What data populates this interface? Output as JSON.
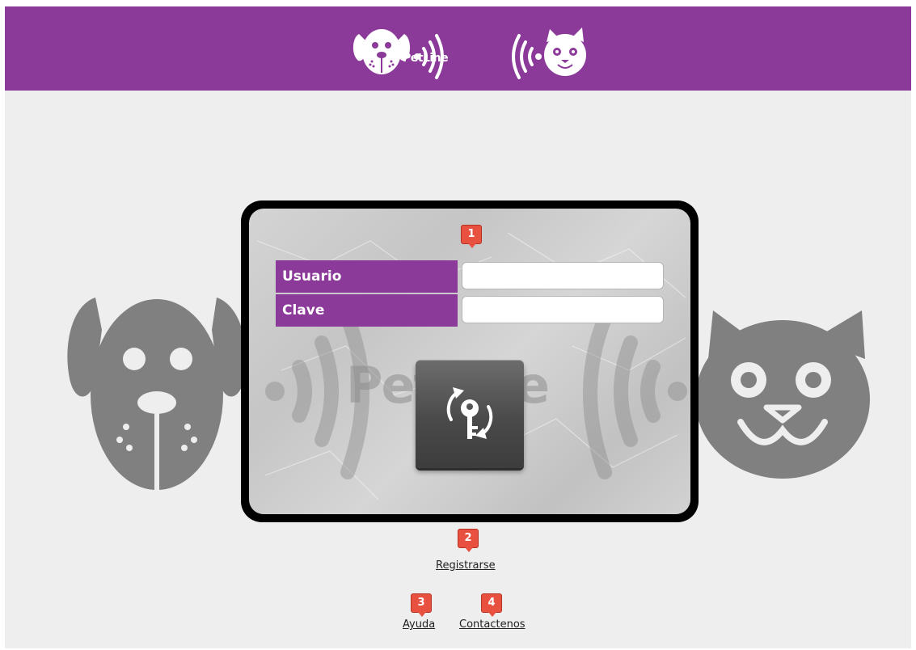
{
  "header": {
    "logo_text": "PetLine",
    "brand_color": "#8b3a99"
  },
  "background": {
    "watermark_text": "PetLine"
  },
  "login": {
    "user_label": "Usuario",
    "user_value": "",
    "pass_label": "Clave",
    "pass_value": "",
    "submit_icon": "key-refresh-icon"
  },
  "badges": {
    "b1": "1",
    "b2": "2",
    "b3": "3",
    "b4": "4",
    "color": "#e8513f"
  },
  "links": {
    "register": "Registrarse",
    "help": "Ayuda",
    "contact": "Contactenos"
  }
}
